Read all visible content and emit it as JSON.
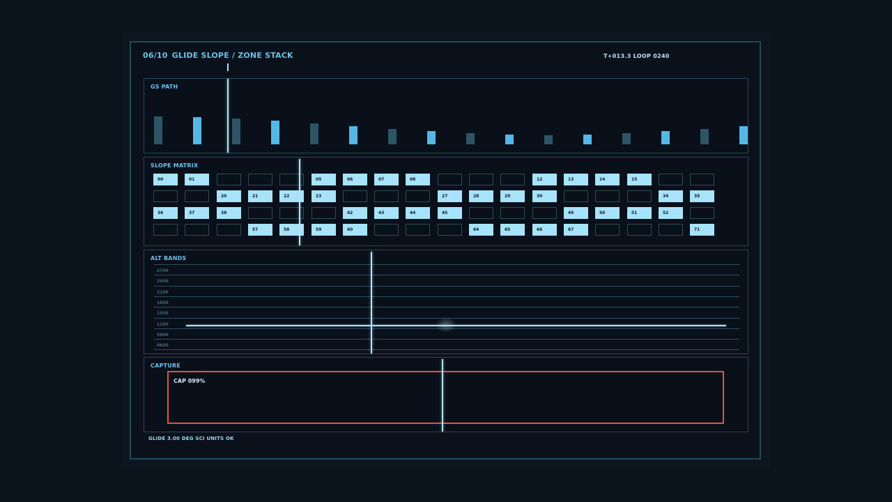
{
  "header": {
    "index": "06/10",
    "title": "GLIDE SLOPE / ZONE STACK",
    "clock": "T+013.3  LOOP 0240"
  },
  "gs_path": {
    "label": "GS PATH",
    "bars": [
      {
        "level": 0.4,
        "style": "dim"
      },
      {
        "level": 0.39,
        "style": "bright"
      },
      {
        "level": 0.37,
        "style": "dim"
      },
      {
        "level": 0.34,
        "style": "bright"
      },
      {
        "level": 0.3,
        "style": "dim"
      },
      {
        "level": 0.26,
        "style": "bright"
      },
      {
        "level": 0.22,
        "style": "dim"
      },
      {
        "level": 0.19,
        "style": "bright"
      },
      {
        "level": 0.16,
        "style": "dim"
      },
      {
        "level": 0.14,
        "style": "bright"
      },
      {
        "level": 0.13,
        "style": "dim"
      },
      {
        "level": 0.14,
        "style": "bright"
      },
      {
        "level": 0.16,
        "style": "dim"
      },
      {
        "level": 0.19,
        "style": "bright"
      },
      {
        "level": 0.22,
        "style": "dim"
      },
      {
        "level": 0.26,
        "style": "bright"
      }
    ]
  },
  "slope_matrix": {
    "label": "SLOPE MATRIX",
    "rows": [
      [
        "00",
        "01",
        "",
        "",
        "",
        "05",
        "06",
        "07",
        "08",
        "",
        "",
        "",
        "12",
        "13",
        "14",
        "15",
        "",
        ""
      ],
      [
        "",
        "",
        "20",
        "21",
        "22",
        "23",
        "",
        "",
        "",
        "27",
        "28",
        "29",
        "30",
        "",
        "",
        "",
        "34",
        "35"
      ],
      [
        "36",
        "37",
        "38",
        "",
        "",
        "",
        "42",
        "43",
        "44",
        "45",
        "",
        "",
        "",
        "49",
        "50",
        "51",
        "52",
        ""
      ],
      [
        "",
        "",
        "",
        "57",
        "58",
        "59",
        "60",
        "",
        "",
        "",
        "64",
        "65",
        "66",
        "67",
        "",
        "",
        "",
        "71"
      ]
    ]
  },
  "alt_bands": {
    "label": "ALT BANDS",
    "levels": [
      "2700",
      "2400",
      "2100",
      "1800",
      "1500",
      "1200",
      "0900",
      "0600"
    ]
  },
  "capture": {
    "label": "CAPTURE",
    "value": "CAP 099%"
  },
  "footer": {
    "status": "GLIDE 3.00 DEG  SCI UNITS OK"
  },
  "colors": {
    "bright": "#55b7e6",
    "dim": "#2e5565",
    "accent_box": "#e0553b"
  }
}
